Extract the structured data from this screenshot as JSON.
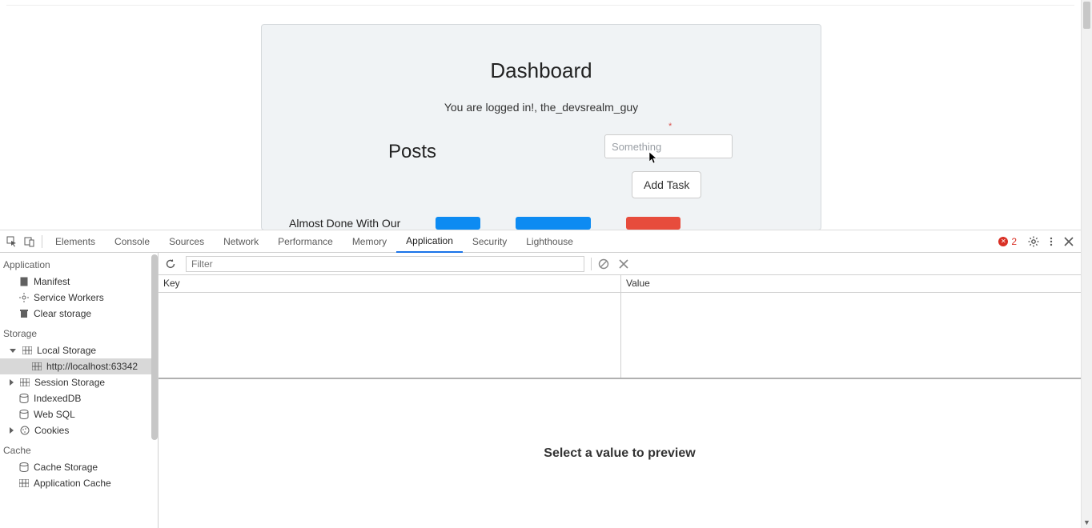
{
  "page": {
    "title": "Dashboard",
    "logged_in_text": "You are logged in!, the_devsrealm_guy",
    "required_mark": "*",
    "posts_heading": "Posts",
    "something_placeholder": "Something",
    "add_task_label": "Add Task",
    "list_item_text": "Almost Done With Our"
  },
  "devtools": {
    "tabs": {
      "elements": "Elements",
      "console": "Console",
      "sources": "Sources",
      "network": "Network",
      "performance": "Performance",
      "memory": "Memory",
      "application": "Application",
      "security": "Security",
      "lighthouse": "Lighthouse"
    },
    "errors_count": "2",
    "sidebar": {
      "application_group": "Application",
      "manifest": "Manifest",
      "service_workers": "Service Workers",
      "clear_storage": "Clear storage",
      "storage_group": "Storage",
      "local_storage": "Local Storage",
      "local_storage_origin": "http://localhost:63342",
      "session_storage": "Session Storage",
      "indexed_db": "IndexedDB",
      "web_sql": "Web SQL",
      "cookies": "Cookies",
      "cache_group": "Cache",
      "cache_storage": "Cache Storage",
      "application_cache": "Application Cache"
    },
    "toolbar": {
      "filter_placeholder": "Filter"
    },
    "kv": {
      "key_header": "Key",
      "value_header": "Value"
    },
    "preview_empty": "Select a value to preview"
  }
}
